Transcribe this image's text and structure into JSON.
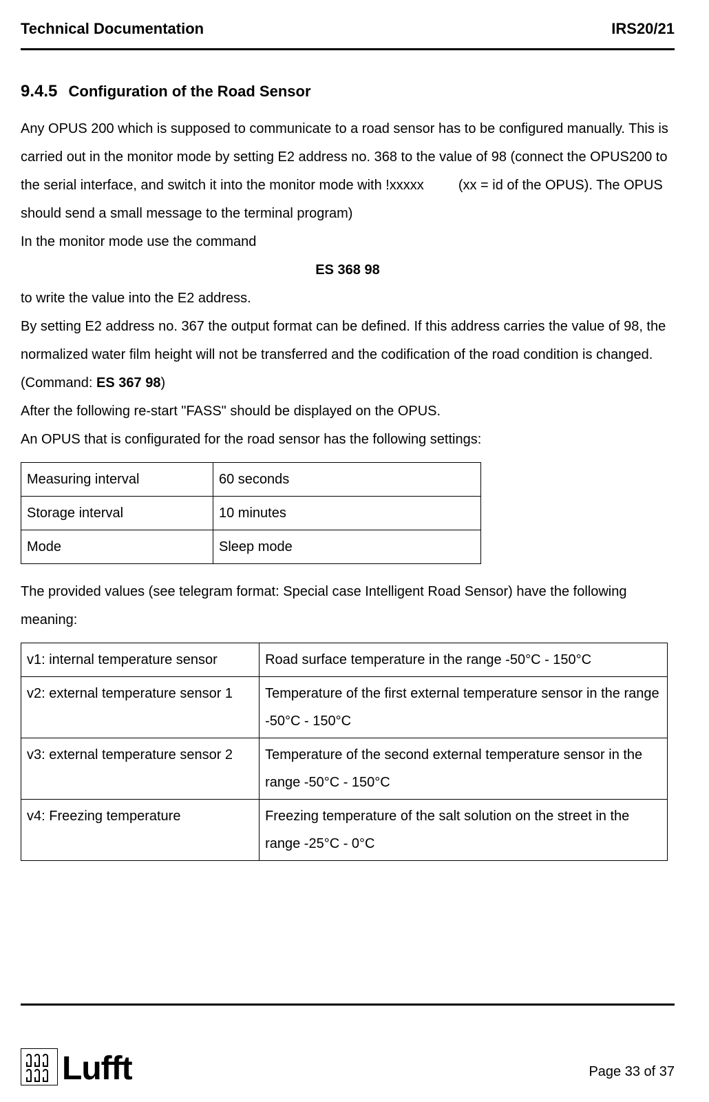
{
  "header": {
    "left": "Technical Documentation",
    "right": "IRS20/21"
  },
  "section": {
    "number": "9.4.5",
    "title": "Configuration of the Road Sensor"
  },
  "para1": {
    "a": "Any OPUS 200 which is supposed to communicate to a road sensor has to be configured manually. This is carried out in the monitor mode by setting E2 address no. 368 to the value of 98 (connect the OPUS200 to the serial interface, and switch it into the monitor mode with !xxxxx",
    "b": "(xx = id of the OPUS). The OPUS should send a small message to the terminal program)"
  },
  "para2": "In the monitor mode use the command",
  "command1": "ES 368 98",
  "para3": "to write the value into the E2 address.",
  "para4": {
    "a": "By setting E2 address no. 367 the output format can be defined. If this address carries the value of 98, the normalized water film height will not be transferred and the codification of the road condition is changed. (Command: ",
    "cmd": "ES 367 98",
    "b": ")"
  },
  "para5": "After the following re-start \"FASS\" should be displayed on the OPUS.",
  "para6": "An OPUS that is configurated for the road sensor has the following settings:",
  "table1": {
    "rows": [
      {
        "label": "Measuring interval",
        "value": "60 seconds"
      },
      {
        "label": "Storage interval",
        "value": "10 minutes"
      },
      {
        "label": "Mode",
        "value": "Sleep mode"
      }
    ]
  },
  "para7": "The provided values (see telegram format: Special case Intelligent Road Sensor) have the following meaning:",
  "table2": {
    "rows": [
      {
        "label": "v1: internal temperature sensor",
        "value": "Road surface temperature in the range -50°C - 150°C"
      },
      {
        "label": "v2: external temperature sensor 1",
        "value": "Temperature of the first external temperature sensor in the range -50°C - 150°C"
      },
      {
        "label": "v3: external temperature sensor 2",
        "value": "Temperature of the second external temperature sensor in the range -50°C - 150°C"
      },
      {
        "label": "v4: Freezing temperature",
        "value": "Freezing temperature of the salt solution on the street in the range -25°C - 0°C"
      }
    ]
  },
  "footer": {
    "logo_text": "Lufft",
    "page": "Page 33 of 37"
  }
}
